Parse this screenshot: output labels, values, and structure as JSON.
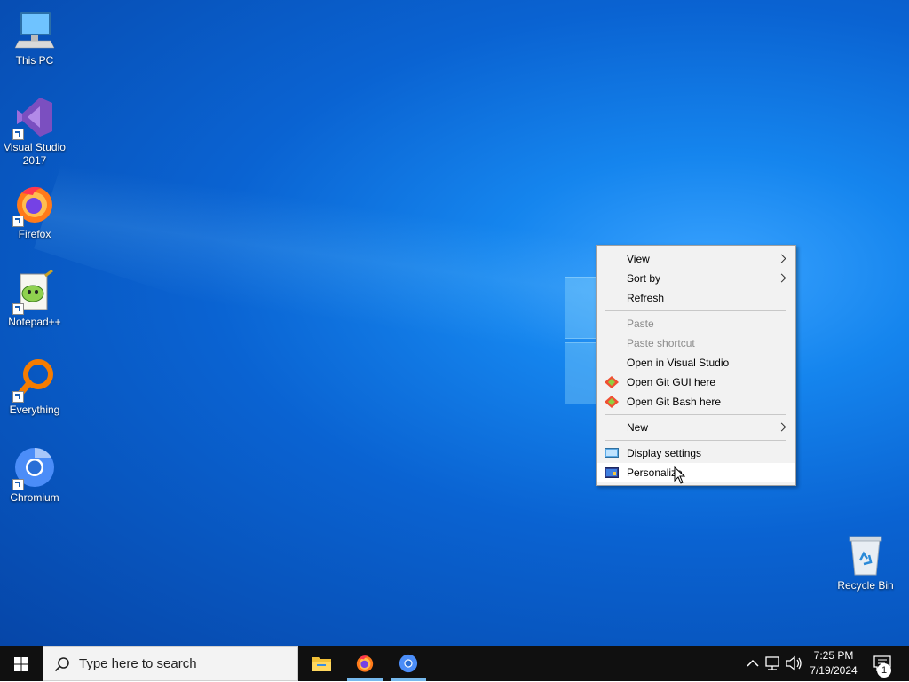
{
  "desktop": {
    "icons": [
      {
        "label": "This PC",
        "icon": "computer-icon"
      },
      {
        "label": "Visual Studio 2017",
        "icon": "visual-studio-icon"
      },
      {
        "label": "Firefox",
        "icon": "firefox-icon"
      },
      {
        "label": "Notepad++",
        "icon": "notepadpp-icon"
      },
      {
        "label": "Everything",
        "icon": "everything-search-icon"
      },
      {
        "label": "Chromium",
        "icon": "chromium-icon"
      },
      {
        "label": "Recycle Bin",
        "icon": "recycle-bin-icon"
      }
    ]
  },
  "context_menu": {
    "items": {
      "view": "View",
      "sort_by": "Sort by",
      "refresh": "Refresh",
      "paste": "Paste",
      "paste_shortcut": "Paste shortcut",
      "open_vs": "Open in Visual Studio",
      "git_gui": "Open Git GUI here",
      "git_bash": "Open Git Bash here",
      "new": "New",
      "display_settings": "Display settings",
      "personalize": "Personalize"
    },
    "disabled": [
      "Paste",
      "Paste shortcut"
    ],
    "hovered": "Personalize"
  },
  "taskbar": {
    "search_placeholder": "Type here to search",
    "pinned": [
      "file-explorer-icon",
      "firefox-icon",
      "chromium-icon"
    ],
    "active_app": "chromium",
    "clock": {
      "time": "7:25 PM",
      "date": "7/19/2024"
    },
    "notification_count": "1"
  },
  "colors": {
    "taskbar_bg": "#101010",
    "menu_bg": "#f2f2f2",
    "accent": "#0a63d2"
  }
}
